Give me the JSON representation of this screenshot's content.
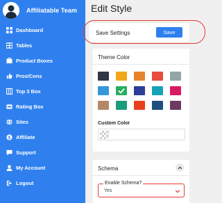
{
  "brand": {
    "name": "Affiliatable Team"
  },
  "sidebar": {
    "items": [
      {
        "label": "Dashboard",
        "icon": "dashboard-icon"
      },
      {
        "label": "Tables",
        "icon": "table-icon"
      },
      {
        "label": "Product Boxes",
        "icon": "product-box-icon"
      },
      {
        "label": "Pros/Cons",
        "icon": "thumbs-icon"
      },
      {
        "label": "Top 3 Box",
        "icon": "top-box-icon"
      },
      {
        "label": "Rating Box",
        "icon": "rating-icon"
      },
      {
        "label": "Sites",
        "icon": "globe-icon"
      },
      {
        "label": "Affiliate",
        "icon": "dollar-icon"
      },
      {
        "label": "Support",
        "icon": "support-icon"
      },
      {
        "label": "My Account",
        "icon": "user-icon"
      },
      {
        "label": "Logout",
        "icon": "logout-icon"
      }
    ]
  },
  "page": {
    "title": "Edit Style"
  },
  "save_settings": {
    "label": "Save Settings",
    "button": "Save"
  },
  "theme": {
    "title": "Theme Color",
    "swatches": [
      {
        "color": "#2f3744",
        "selected": false
      },
      {
        "color": "#f3a71a",
        "selected": false
      },
      {
        "color": "#e6842a",
        "selected": false
      },
      {
        "color": "#e84c3d",
        "selected": false
      },
      {
        "color": "#95a5a6",
        "selected": false
      },
      {
        "color": "#3498db",
        "selected": false
      },
      {
        "color": "#27ae60",
        "selected": true
      },
      {
        "color": "#2c3e96",
        "selected": false
      },
      {
        "color": "#17a2b8",
        "selected": false
      },
      {
        "color": "#d81b60",
        "selected": false
      },
      {
        "color": "#b5886a",
        "selected": false
      },
      {
        "color": "#1a9b7a",
        "selected": false
      },
      {
        "color": "#e8401c",
        "selected": false
      },
      {
        "color": "#1e4f7e",
        "selected": false
      },
      {
        "color": "#6d3b5f",
        "selected": false
      }
    ],
    "custom_label": "Custom Color",
    "custom_value": ""
  },
  "schema": {
    "title": "Schema",
    "field_label": "Enable Schema?",
    "field_value": "Yes"
  },
  "colors": {
    "accent": "#2f80ee",
    "highlight": "#e53935"
  }
}
